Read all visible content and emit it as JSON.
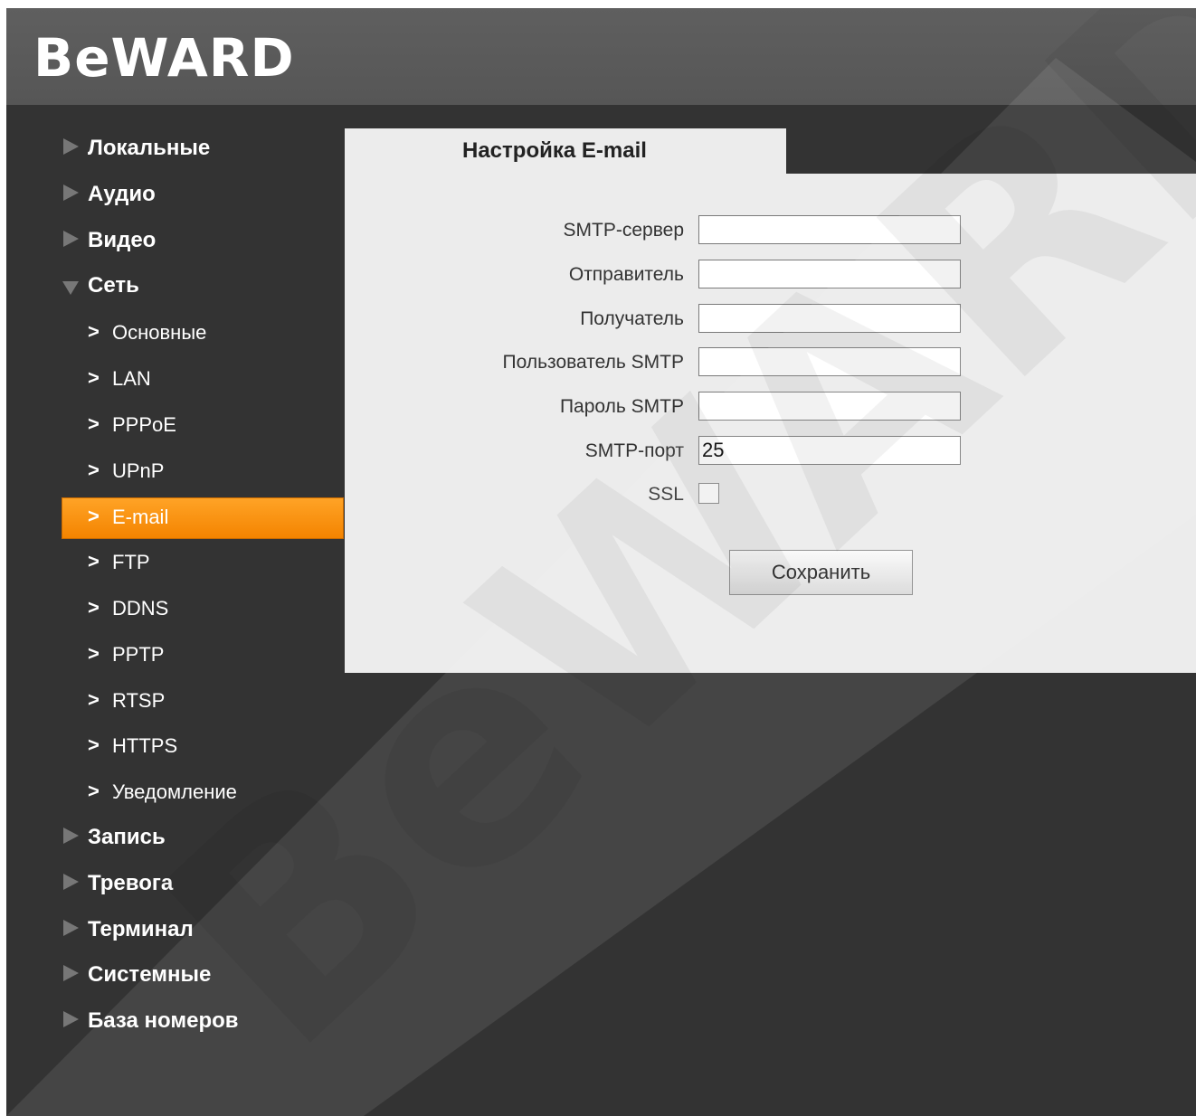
{
  "brand": {
    "logo_text": "BeWARD"
  },
  "sidebar": {
    "top_items": [
      {
        "label": "Локальные"
      },
      {
        "label": "Аудио"
      },
      {
        "label": "Видео"
      }
    ],
    "expanded_item": {
      "label": "Сеть"
    },
    "sub_items": [
      {
        "label": "Основные"
      },
      {
        "label": "LAN"
      },
      {
        "label": "PPPoE"
      },
      {
        "label": "UPnP"
      },
      {
        "label": "E-mail"
      },
      {
        "label": "FTP"
      },
      {
        "label": "DDNS"
      },
      {
        "label": "PPTP"
      },
      {
        "label": "RTSP"
      },
      {
        "label": "HTTPS"
      },
      {
        "label": "Уведомление"
      }
    ],
    "active_sub_item": "E-mail",
    "bottom_items": [
      {
        "label": "Запись"
      },
      {
        "label": "Тревога"
      },
      {
        "label": "Терминал"
      },
      {
        "label": "Системные"
      },
      {
        "label": "База номеров"
      }
    ]
  },
  "tab": {
    "title": "Настройка E-mail"
  },
  "form": {
    "smtp_server": {
      "label": "SMTP-сервер",
      "value": ""
    },
    "sender": {
      "label": "Отправитель",
      "value": ""
    },
    "recipient": {
      "label": "Получатель",
      "value": ""
    },
    "smtp_user": {
      "label": "Пользователь SMTP",
      "value": ""
    },
    "smtp_password": {
      "label": "Пароль SMTP",
      "value": ""
    },
    "smtp_port": {
      "label": "SMTP-порт",
      "value": "25"
    },
    "ssl": {
      "label": "SSL",
      "checked": false
    }
  },
  "buttons": {
    "save_label": "Сохранить"
  },
  "colors": {
    "background": "#333333",
    "header": "#5a5a5a",
    "panel": "#ececec",
    "active_nav": "#f89a10"
  }
}
